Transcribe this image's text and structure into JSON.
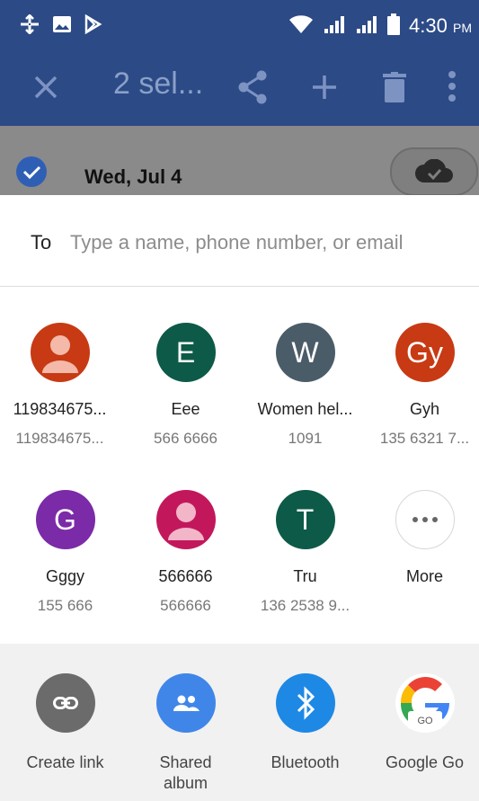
{
  "status_bar": {
    "time": "4:30",
    "ampm": "PM"
  },
  "toolbar": {
    "title": "2 sel..."
  },
  "background_item": {
    "date": "Wed, Jul 4"
  },
  "to_field": {
    "label": "To",
    "placeholder": "Type a name, phone number, or email"
  },
  "contacts": [
    {
      "name": "119834675...",
      "number": "119834675...",
      "avatar_letter": "",
      "avatar_color": "#c73a14"
    },
    {
      "name": "Eee",
      "number": "566 6666",
      "avatar_letter": "E",
      "avatar_color": "#0d5a48"
    },
    {
      "name": "Women hel...",
      "number": "1091",
      "avatar_letter": "W",
      "avatar_color": "#4a5c68"
    },
    {
      "name": "Gyh",
      "number": "135 6321 7...",
      "avatar_letter": "Gy",
      "avatar_color": "#c73a14"
    },
    {
      "name": "Gggy",
      "number": "155 666",
      "avatar_letter": "G",
      "avatar_color": "#7b2aa8"
    },
    {
      "name": "566666",
      "number": "566666",
      "avatar_letter": "",
      "avatar_color": "#c2185b"
    },
    {
      "name": "Tru",
      "number": "136 2538 9...",
      "avatar_letter": "T",
      "avatar_color": "#0d5a48"
    },
    {
      "name": "More",
      "number": "",
      "avatar_letter": "",
      "avatar_color": "#ffffff"
    }
  ],
  "apps": [
    {
      "label": "Create link",
      "color": "#6b6b6b"
    },
    {
      "label": "Shared album",
      "color": "#3f86e8"
    },
    {
      "label": "Bluetooth",
      "color": "#1e88e5"
    },
    {
      "label": "Google Go",
      "color": "#ffffff",
      "badge": "GO"
    }
  ]
}
